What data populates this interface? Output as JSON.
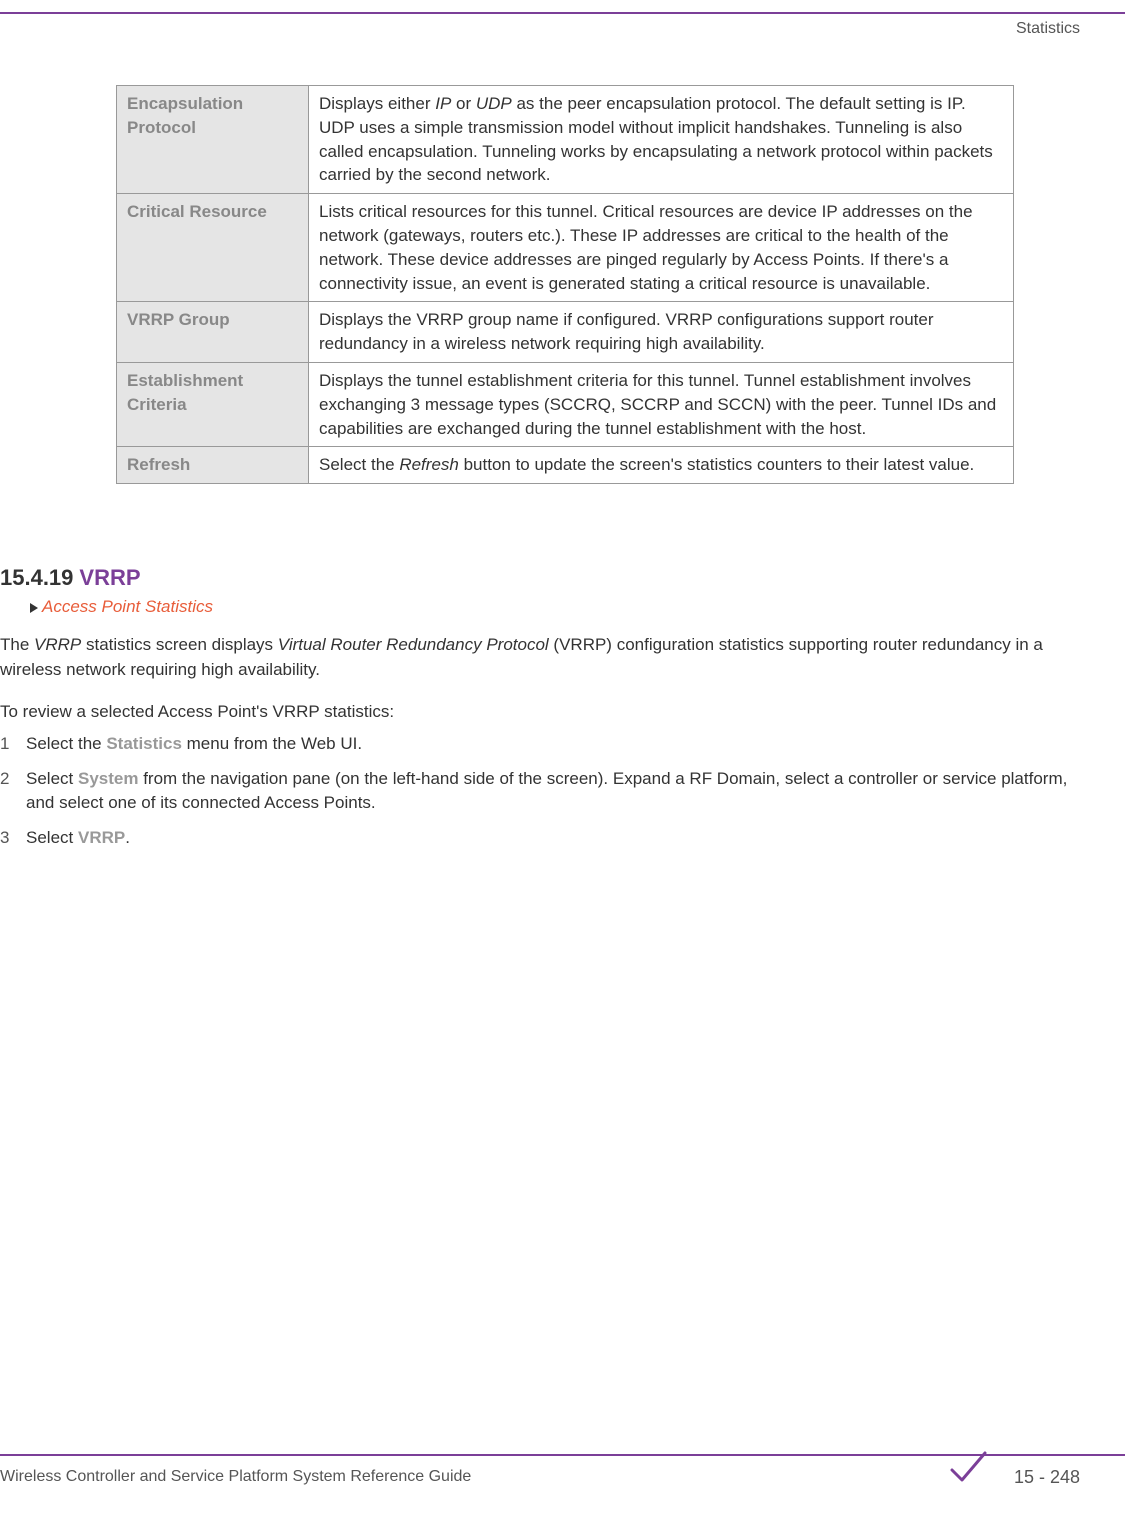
{
  "header": {
    "title": "Statistics"
  },
  "table": {
    "rows": [
      {
        "label": "Encapsulation Protocol",
        "desc_pre": "Displays either ",
        "italic1": "IP",
        "desc_mid1": " or ",
        "italic2": "UDP",
        "desc_post": " as the peer encapsulation protocol. The default setting is IP. UDP uses a simple transmission model without implicit handshakes. Tunneling is also called encapsulation. Tunneling works by encapsulating a network protocol within packets carried by the second network."
      },
      {
        "label": "Critical Resource",
        "desc": "Lists critical resources for this tunnel. Critical resources are device IP addresses on the network (gateways, routers etc.). These IP addresses are critical to the health of the network. These device addresses are pinged regularly by Access Points. If there's a connectivity issue, an event is generated stating a critical resource is unavailable."
      },
      {
        "label": "VRRP Group",
        "desc": "Displays the VRRP group name if configured. VRRP configurations support router redundancy in a wireless network requiring high availability."
      },
      {
        "label": "Establishment Criteria",
        "desc": "Displays the tunnel establishment criteria for this tunnel. Tunnel establishment involves exchanging 3 message types (SCCRQ, SCCRP and SCCN) with the peer. Tunnel IDs and capabilities are exchanged during the tunnel establishment with the host."
      },
      {
        "label": "Refresh",
        "desc_pre": "Select the ",
        "italic1": "Refresh",
        "desc_post": " button to update the screen's statistics counters to their latest value."
      }
    ]
  },
  "section": {
    "number": "15.4.19",
    "name": "VRRP",
    "breadcrumb": "Access Point Statistics",
    "intro_pre": "The ",
    "intro_italic1": "VRRP",
    "intro_mid1": " statistics screen displays ",
    "intro_italic2": "Virtual Router Redundancy Protocol",
    "intro_post": " (VRRP) configuration statistics supporting router redundancy in a wireless network requiring high availability.",
    "intro2": "To review a selected Access Point's VRRP statistics:",
    "steps": [
      {
        "num": "1",
        "pre": "Select the ",
        "bold": "Statistics",
        "post": " menu from the Web UI."
      },
      {
        "num": "2",
        "pre": "Select ",
        "bold": "System",
        "post": " from the navigation pane (on the left-hand side of the screen). Expand a RF Domain, select a controller or service platform, and select one of its connected Access Points."
      },
      {
        "num": "3",
        "pre": "Select ",
        "bold": "VRRP",
        "post": "."
      }
    ]
  },
  "footer": {
    "left": "Wireless Controller and Service Platform System Reference Guide",
    "right": "15 - 248"
  }
}
